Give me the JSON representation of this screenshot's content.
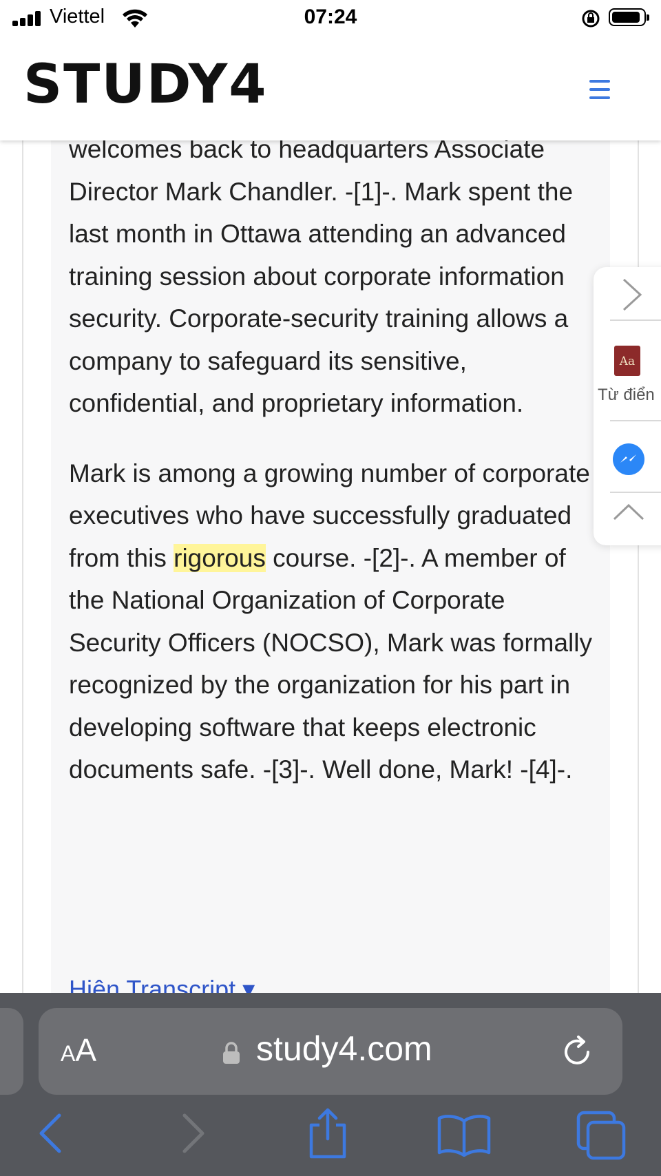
{
  "status_bar": {
    "carrier": "Viettel",
    "time": "07:24"
  },
  "header": {
    "logo": "STUDY4"
  },
  "passage": {
    "paragraph1_fragment": "welcomes back to headquarters",
    "paragraph1_rest": "Associate Director Mark Chandler. -[1]-. Mark spent the last month in Ottawa attending an advanced training session about corporate information security. Corporate-security training allows a company to safeguard its sensitive, confidential, and proprietary information.",
    "paragraph2_before": "Mark is among a growing number of corporate executives who have successfully graduated from this ",
    "paragraph2_highlight": "rigorous",
    "paragraph2_after": " course. -[2]-. A member of the National Organization of Corporate Security Officers (NOCSO), Mark was formally recognized by the organization for his part in developing software that keeps electronic documents safe. -[3]-. Well done, Mark! -[4]-.",
    "transcript_link": "Hiện Transcript",
    "highlight_color": "#fff59a"
  },
  "float_panel": {
    "dictionary_icon_text": "Aa",
    "dictionary_label": "Từ điển"
  },
  "browser": {
    "aa_small": "A",
    "aa_large": "A",
    "url": "study4.com"
  },
  "colors": {
    "accent": "#3d79e0",
    "link": "#2f55c8",
    "safari_bg": "#55575c",
    "safari_field": "#6e6f73"
  }
}
